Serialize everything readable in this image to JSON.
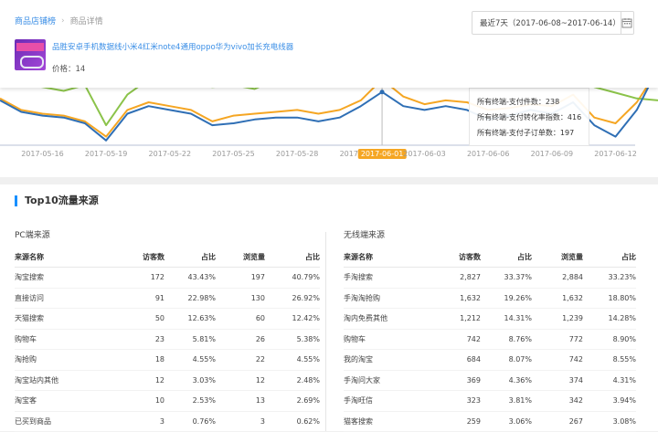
{
  "breadcrumb": {
    "shop": "商品店铺榜",
    "current": "商品详情"
  },
  "date_range": "最近7天（2017-06-08~2017-06-14）",
  "product": {
    "title": "品胜安卓手机数据线小米4红米note4通用oppo华为vivo加长充电线器",
    "price_label": "价格：14"
  },
  "chart_data": {
    "type": "line",
    "x": [
      "2017-05-14",
      "2017-05-15",
      "2017-05-16",
      "2017-05-17",
      "2017-05-18",
      "2017-05-19",
      "2017-05-20",
      "2017-05-21",
      "2017-05-22",
      "2017-05-23",
      "2017-05-24",
      "2017-05-25",
      "2017-05-26",
      "2017-05-27",
      "2017-05-28",
      "2017-05-29",
      "2017-05-30",
      "2017-05-31",
      "2017-06-01",
      "2017-06-02",
      "2017-06-03",
      "2017-06-04",
      "2017-06-05",
      "2017-06-06",
      "2017-06-07",
      "2017-06-08",
      "2017-06-09",
      "2017-06-10",
      "2017-06-11",
      "2017-06-12",
      "2017-06-13",
      "2017-06-14"
    ],
    "xticks": [
      "2017-05-16",
      "2017-05-19",
      "2017-05-22",
      "2017-05-25",
      "2017-05-28",
      "2017-05-31",
      "2017-06-01",
      "2017-06-03",
      "2017-06-06",
      "2017-06-09",
      "2017-06-12"
    ],
    "highlight_tick": "2017-06-01",
    "series": [
      {
        "name": "所有终端-支付件数",
        "color": "#f5a623",
        "values": [
          180,
          150,
          140,
          135,
          120,
          80,
          150,
          170,
          160,
          150,
          120,
          135,
          140,
          145,
          150,
          140,
          150,
          175,
          230,
          185,
          165,
          175,
          170,
          150,
          155,
          165,
          160,
          190,
          130,
          115,
          170,
          255
        ]
      },
      {
        "name": "所有终端-支付转化率指数",
        "color": "#8bc34a",
        "values": [
          240,
          220,
          210,
          200,
          215,
          110,
          190,
          230,
          225,
          220,
          210,
          215,
          205,
          230,
          225,
          215,
          220,
          245,
          416,
          230,
          225,
          230,
          235,
          220,
          215,
          220,
          230,
          240,
          210,
          195,
          180,
          175
        ]
      },
      {
        "name": "所有终端-支付子订单数",
        "color": "#2f6fb5",
        "values": [
          175,
          145,
          135,
          130,
          115,
          70,
          140,
          160,
          150,
          140,
          110,
          115,
          125,
          130,
          130,
          120,
          130,
          160,
          197,
          160,
          150,
          160,
          150,
          125,
          135,
          150,
          140,
          170,
          110,
          80,
          150,
          260
        ]
      }
    ],
    "tooltip_rows": [
      "所有终端-支付件数：238",
      "所有终端-支付转化率指数：416",
      "所有终端-支付子订单数：197"
    ]
  },
  "section_title": "Top10流量来源",
  "pc": {
    "title": "PC端来源",
    "headers": [
      "来源名称",
      "访客数",
      "占比",
      "浏览量",
      "占比"
    ],
    "rows": [
      [
        "淘宝搜索",
        "172",
        "43.43%",
        "197",
        "40.79%"
      ],
      [
        "直接访问",
        "91",
        "22.98%",
        "130",
        "26.92%"
      ],
      [
        "天猫搜索",
        "50",
        "12.63%",
        "60",
        "12.42%"
      ],
      [
        "购物车",
        "23",
        "5.81%",
        "26",
        "5.38%"
      ],
      [
        "淘抢购",
        "18",
        "4.55%",
        "22",
        "4.55%"
      ],
      [
        "淘宝站内其他",
        "12",
        "3.03%",
        "12",
        "2.48%"
      ],
      [
        "淘宝客",
        "10",
        "2.53%",
        "13",
        "2.69%"
      ],
      [
        "已买到商品",
        "3",
        "0.76%",
        "3",
        "0.62%"
      ]
    ]
  },
  "mobile": {
    "title": "无线端来源",
    "headers": [
      "来源名称",
      "访客数",
      "占比",
      "浏览量",
      "占比"
    ],
    "rows": [
      [
        "手淘搜索",
        "2,827",
        "33.37%",
        "2,884",
        "33.23%"
      ],
      [
        "手淘淘抢购",
        "1,632",
        "19.26%",
        "1,632",
        "18.80%"
      ],
      [
        "淘内免费其他",
        "1,212",
        "14.31%",
        "1,239",
        "14.28%"
      ],
      [
        "购物车",
        "742",
        "8.76%",
        "772",
        "8.90%"
      ],
      [
        "我的淘宝",
        "684",
        "8.07%",
        "742",
        "8.55%"
      ],
      [
        "手淘问大家",
        "369",
        "4.36%",
        "374",
        "4.31%"
      ],
      [
        "手淘旺信",
        "323",
        "3.81%",
        "342",
        "3.94%"
      ],
      [
        "猫客搜索",
        "259",
        "3.06%",
        "267",
        "3.08%"
      ]
    ]
  }
}
